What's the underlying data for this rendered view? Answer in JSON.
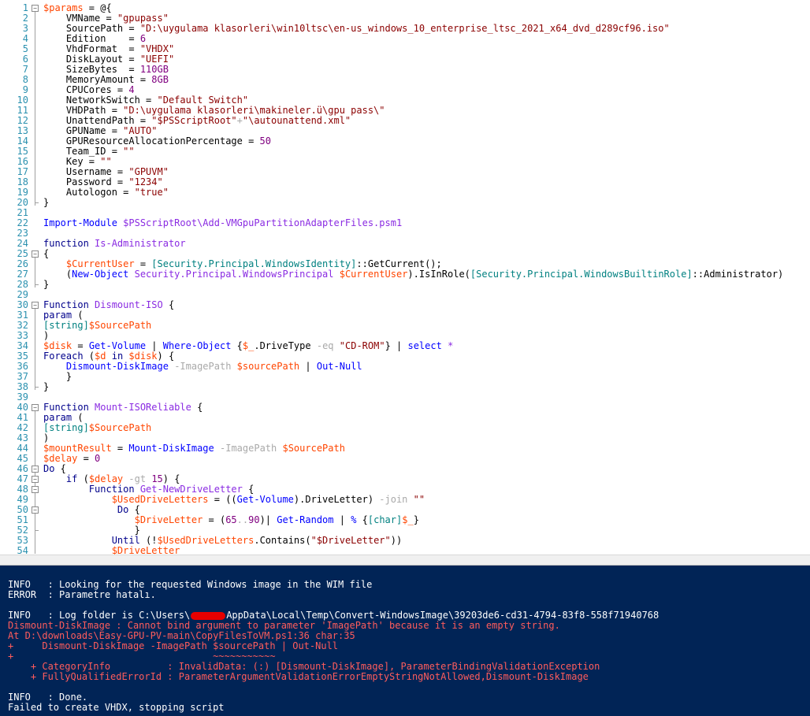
{
  "editor": {
    "lines": [
      {
        "n": "1",
        "t": [
          [
            "$params",
            "var"
          ],
          [
            " = @{",
            "grp"
          ]
        ]
      },
      {
        "n": "2",
        "t": [
          [
            "    VMName = ",
            "grp"
          ],
          [
            "\"gpupass\"",
            "str"
          ]
        ]
      },
      {
        "n": "3",
        "t": [
          [
            "    SourcePath = ",
            "grp"
          ],
          [
            "\"D:\\uygulama klasorleri\\win10ltsc\\en-us_windows_10_enterprise_ltsc_2021_x64_dvd_d289cf96.iso\"",
            "str"
          ]
        ]
      },
      {
        "n": "4",
        "t": [
          [
            "    Edition    = ",
            "grp"
          ],
          [
            "6",
            "num"
          ]
        ]
      },
      {
        "n": "5",
        "t": [
          [
            "    VhdFormat  = ",
            "grp"
          ],
          [
            "\"VHDX\"",
            "str"
          ]
        ]
      },
      {
        "n": "6",
        "t": [
          [
            "    DiskLayout = ",
            "grp"
          ],
          [
            "\"UEFI\"",
            "str"
          ]
        ]
      },
      {
        "n": "7",
        "t": [
          [
            "    SizeBytes  = ",
            "grp"
          ],
          [
            "110GB",
            "num"
          ]
        ]
      },
      {
        "n": "8",
        "t": [
          [
            "    MemoryAmount = ",
            "grp"
          ],
          [
            "8GB",
            "num"
          ]
        ]
      },
      {
        "n": "9",
        "t": [
          [
            "    CPUCores = ",
            "grp"
          ],
          [
            "4",
            "num"
          ]
        ]
      },
      {
        "n": "10",
        "t": [
          [
            "    NetworkSwitch = ",
            "grp"
          ],
          [
            "\"Default Switch\"",
            "str"
          ]
        ]
      },
      {
        "n": "11",
        "t": [
          [
            "    VHDPath = ",
            "grp"
          ],
          [
            "\"D:\\uygulama klasorleri\\makineler.ü\\gpu pass\\\"",
            "str"
          ]
        ]
      },
      {
        "n": "12",
        "t": [
          [
            "    UnattendPath = ",
            "grp"
          ],
          [
            "\"$PSScriptRoot\"",
            "str"
          ],
          [
            "+",
            "op"
          ],
          [
            "\"\\autounattend.xml\"",
            "str"
          ]
        ]
      },
      {
        "n": "13",
        "t": [
          [
            "    GPUName = ",
            "grp"
          ],
          [
            "\"AUTO\"",
            "str"
          ]
        ]
      },
      {
        "n": "14",
        "t": [
          [
            "    GPUResourceAllocationPercentage = ",
            "grp"
          ],
          [
            "50",
            "num"
          ]
        ]
      },
      {
        "n": "15",
        "t": [
          [
            "    Team_ID = ",
            "grp"
          ],
          [
            "\"\"",
            "str"
          ]
        ]
      },
      {
        "n": "16",
        "t": [
          [
            "    Key = ",
            "grp"
          ],
          [
            "\"\"",
            "str"
          ]
        ]
      },
      {
        "n": "17",
        "t": [
          [
            "    Username = ",
            "grp"
          ],
          [
            "\"GPUVM\"",
            "str"
          ]
        ]
      },
      {
        "n": "18",
        "t": [
          [
            "    Password = ",
            "grp"
          ],
          [
            "\"1234\"",
            "str"
          ]
        ]
      },
      {
        "n": "19",
        "t": [
          [
            "    Autologon = ",
            "grp"
          ],
          [
            "\"true\"",
            "str"
          ]
        ]
      },
      {
        "n": "20",
        "t": [
          [
            "}",
            "grp"
          ]
        ]
      },
      {
        "n": "21",
        "t": []
      },
      {
        "n": "22",
        "t": [
          [
            "Import-Module",
            "cmd"
          ],
          [
            " ",
            "grp"
          ],
          [
            "$PSScriptRoot\\Add-VMGpuPartitionAdapterFiles.psm1",
            "cmdarg"
          ]
        ]
      },
      {
        "n": "23",
        "t": []
      },
      {
        "n": "24",
        "t": [
          [
            "function",
            "kw"
          ],
          [
            " ",
            "grp"
          ],
          [
            "Is-Administrator",
            "cmdarg"
          ]
        ]
      },
      {
        "n": "25",
        "t": [
          [
            "{",
            "grp"
          ]
        ]
      },
      {
        "n": "26",
        "t": [
          [
            "    ",
            "grp"
          ],
          [
            "$CurrentUser",
            "var"
          ],
          [
            " = ",
            "grp"
          ],
          [
            "[Security.Principal.WindowsIdentity]",
            "type"
          ],
          [
            "::GetCurrent();",
            "mem"
          ]
        ]
      },
      {
        "n": "27",
        "t": [
          [
            "    (",
            "grp"
          ],
          [
            "New-Object",
            "cmd"
          ],
          [
            " ",
            "grp"
          ],
          [
            "Security.Principal.WindowsPrincipal",
            "cmdarg"
          ],
          [
            " ",
            "grp"
          ],
          [
            "$CurrentUser",
            "var"
          ],
          [
            ").IsInRole(",
            "mem"
          ],
          [
            "[Security.Principal.WindowsBuiltinRole]",
            "type"
          ],
          [
            "::Administrator)",
            "mem"
          ]
        ]
      },
      {
        "n": "28",
        "t": [
          [
            "}",
            "grp"
          ]
        ]
      },
      {
        "n": "29",
        "t": []
      },
      {
        "n": "30",
        "t": [
          [
            "Function",
            "kw"
          ],
          [
            " ",
            "grp"
          ],
          [
            "Dismount-ISO",
            "cmdarg"
          ],
          [
            " {",
            "grp"
          ]
        ]
      },
      {
        "n": "31",
        "t": [
          [
            "param",
            "kw"
          ],
          [
            " (",
            "grp"
          ]
        ]
      },
      {
        "n": "32",
        "t": [
          [
            "[string]",
            "type"
          ],
          [
            "$SourcePath",
            "var"
          ]
        ]
      },
      {
        "n": "33",
        "t": [
          [
            ")",
            "grp"
          ]
        ]
      },
      {
        "n": "34",
        "t": [
          [
            "$disk",
            "var"
          ],
          [
            " = ",
            "grp"
          ],
          [
            "Get-Volume",
            "cmd"
          ],
          [
            " | ",
            "grp"
          ],
          [
            "Where-Object",
            "cmd"
          ],
          [
            " {",
            "grp"
          ],
          [
            "$_",
            "var"
          ],
          [
            ".DriveType ",
            "mem"
          ],
          [
            "-eq",
            "op"
          ],
          [
            " ",
            "grp"
          ],
          [
            "\"CD-ROM\"",
            "str"
          ],
          [
            "} | ",
            "grp"
          ],
          [
            "select",
            "cmd"
          ],
          [
            " ",
            "grp"
          ],
          [
            "*",
            "cmdarg"
          ]
        ]
      },
      {
        "n": "35",
        "t": [
          [
            "Foreach",
            "kw"
          ],
          [
            " (",
            "grp"
          ],
          [
            "$d",
            "var"
          ],
          [
            " ",
            "grp"
          ],
          [
            "in",
            "kw"
          ],
          [
            " ",
            "grp"
          ],
          [
            "$disk",
            "var"
          ],
          [
            ") {",
            "grp"
          ]
        ]
      },
      {
        "n": "36",
        "t": [
          [
            "    ",
            "grp"
          ],
          [
            "Dismount-DiskImage",
            "cmd"
          ],
          [
            " ",
            "grp"
          ],
          [
            "-ImagePath",
            "op"
          ],
          [
            " ",
            "grp"
          ],
          [
            "$sourcePath",
            "var"
          ],
          [
            " | ",
            "grp"
          ],
          [
            "Out-Null",
            "cmd"
          ]
        ]
      },
      {
        "n": "37",
        "t": [
          [
            "    }",
            "grp"
          ]
        ]
      },
      {
        "n": "38",
        "t": [
          [
            "}",
            "grp"
          ]
        ]
      },
      {
        "n": "39",
        "t": []
      },
      {
        "n": "40",
        "t": [
          [
            "Function",
            "kw"
          ],
          [
            " ",
            "grp"
          ],
          [
            "Mount-ISOReliable",
            "cmdarg"
          ],
          [
            " {",
            "grp"
          ]
        ]
      },
      {
        "n": "41",
        "t": [
          [
            "param",
            "kw"
          ],
          [
            " (",
            "grp"
          ]
        ]
      },
      {
        "n": "42",
        "t": [
          [
            "[string]",
            "type"
          ],
          [
            "$SourcePath",
            "var"
          ]
        ]
      },
      {
        "n": "43",
        "t": [
          [
            ")",
            "grp"
          ]
        ]
      },
      {
        "n": "44",
        "t": [
          [
            "$mountResult",
            "var"
          ],
          [
            " = ",
            "grp"
          ],
          [
            "Mount-DiskImage",
            "cmd"
          ],
          [
            " ",
            "grp"
          ],
          [
            "-ImagePath",
            "op"
          ],
          [
            " ",
            "grp"
          ],
          [
            "$SourcePath",
            "var"
          ]
        ]
      },
      {
        "n": "45",
        "t": [
          [
            "$delay",
            "var"
          ],
          [
            " = ",
            "grp"
          ],
          [
            "0",
            "num"
          ]
        ]
      },
      {
        "n": "46",
        "t": [
          [
            "Do",
            "kw"
          ],
          [
            " {",
            "grp"
          ]
        ]
      },
      {
        "n": "47",
        "t": [
          [
            "    ",
            "grp"
          ],
          [
            "if",
            "kw"
          ],
          [
            " (",
            "grp"
          ],
          [
            "$delay",
            "var"
          ],
          [
            " ",
            "grp"
          ],
          [
            "-gt",
            "op"
          ],
          [
            " ",
            "grp"
          ],
          [
            "15",
            "num"
          ],
          [
            ") {",
            "grp"
          ]
        ]
      },
      {
        "n": "48",
        "t": [
          [
            "        ",
            "grp"
          ],
          [
            "Function",
            "kw"
          ],
          [
            " ",
            "grp"
          ],
          [
            "Get-NewDriveLetter",
            "cmdarg"
          ],
          [
            " {",
            "grp"
          ]
        ]
      },
      {
        "n": "49",
        "t": [
          [
            "            ",
            "grp"
          ],
          [
            "$UsedDriveLetters",
            "var"
          ],
          [
            " = ((",
            "grp"
          ],
          [
            "Get-Volume",
            "cmd"
          ],
          [
            ").DriveLetter) ",
            "mem"
          ],
          [
            "-join",
            "op"
          ],
          [
            " ",
            "grp"
          ],
          [
            "\"\"",
            "str"
          ]
        ]
      },
      {
        "n": "50",
        "t": [
          [
            "             ",
            "grp"
          ],
          [
            "Do",
            "kw"
          ],
          [
            " {",
            "grp"
          ]
        ]
      },
      {
        "n": "51",
        "t": [
          [
            "                ",
            "grp"
          ],
          [
            "$DriveLetter",
            "var"
          ],
          [
            " = (",
            "grp"
          ],
          [
            "65",
            "num"
          ],
          [
            "..",
            "op"
          ],
          [
            "90",
            "num"
          ],
          [
            ")| ",
            "grp"
          ],
          [
            "Get-Random",
            "cmd"
          ],
          [
            " | ",
            "grp"
          ],
          [
            "%",
            "cmd"
          ],
          [
            " {",
            "grp"
          ],
          [
            "[char]",
            "type"
          ],
          [
            "$_",
            "var"
          ],
          [
            "}",
            "grp"
          ]
        ]
      },
      {
        "n": "52",
        "t": [
          [
            "                }",
            "grp"
          ]
        ]
      },
      {
        "n": "53",
        "t": [
          [
            "            ",
            "grp"
          ],
          [
            "Until",
            "kw"
          ],
          [
            " (!",
            "grp"
          ],
          [
            "$UsedDriveLetters",
            "var"
          ],
          [
            ".Contains(",
            "mem"
          ],
          [
            "\"$DriveLetter\"",
            "str"
          ],
          [
            "))",
            "grp"
          ]
        ]
      },
      {
        "n": "54",
        "t": [
          [
            "            ",
            "grp"
          ],
          [
            "$DriveLetter",
            "var"
          ]
        ]
      }
    ]
  },
  "console": {
    "lines": [
      {
        "text": "INFO   : Looking for the requested Windows image in the WIM file",
        "kind": "info"
      },
      {
        "text": "ERROR  : Parametre hatalı.",
        "kind": "info"
      },
      {
        "text": "",
        "kind": "info"
      },
      {
        "text": "INFO   : Log folder is C:\\Users\\",
        "tail": "AppData\\Local\\Temp\\Convert-WindowsImage\\39203de6-cd31-4794-83f8-558f71940768",
        "kind": "info",
        "redacted": true
      },
      {
        "text": "Dismount-DiskImage : Cannot bind argument to parameter 'ImagePath' because it is an empty string.",
        "kind": "err"
      },
      {
        "text": "At D:\\downloads\\Easy-GPU-PV-main\\CopyFilesToVM.ps1:36 char:35",
        "kind": "err"
      },
      {
        "text": "+     Dismount-DiskImage -ImagePath $sourcePath | Out-Null",
        "kind": "err"
      },
      {
        "text": "+                                   ~~~~~~~~~~~",
        "kind": "err"
      },
      {
        "text": "    + CategoryInfo          : InvalidData: (:) [Dismount-DiskImage], ParameterBindingValidationException",
        "kind": "err"
      },
      {
        "text": "    + FullyQualifiedErrorId : ParameterArgumentValidationErrorEmptyStringNotAllowed,Dismount-DiskImage",
        "kind": "err"
      },
      {
        "text": "",
        "kind": "info"
      },
      {
        "text": "INFO   : Done.",
        "kind": "info"
      },
      {
        "text": "Failed to create VHDX, stopping script",
        "kind": "info"
      }
    ]
  },
  "colors": {
    "console_bg": "#012456",
    "error_text": "#ff5c5c",
    "line_numbers": "#2b91af"
  }
}
